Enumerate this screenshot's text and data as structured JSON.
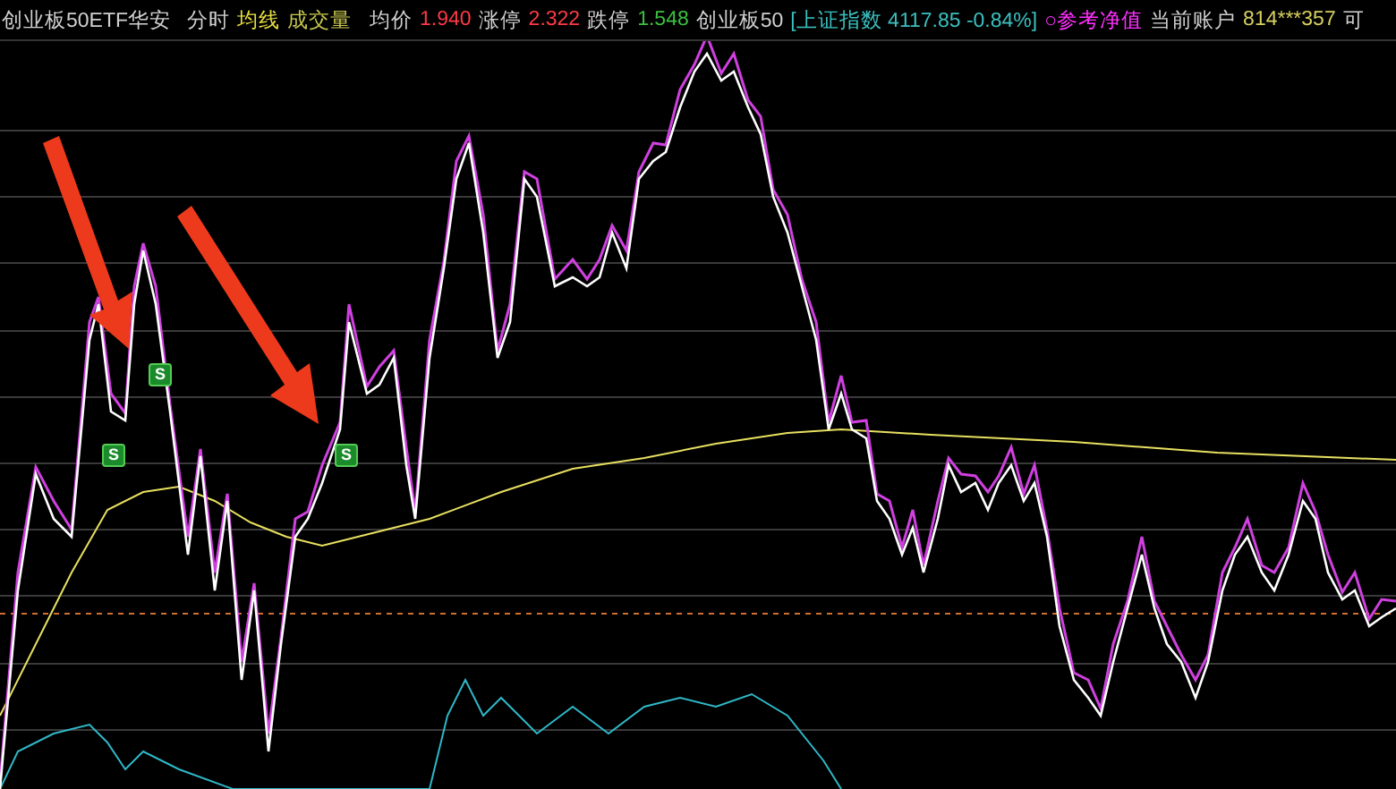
{
  "header": {
    "security": "创业板50ETF华安",
    "view": "分时",
    "indicators": [
      {
        "label": "均线",
        "color": "#e8e040"
      },
      {
        "label": "成交量",
        "color": "#c8c850"
      }
    ],
    "stats": [
      {
        "label": "均价",
        "value": "1.940",
        "kind": "up"
      },
      {
        "label": "涨停",
        "value": "2.322",
        "kind": "up"
      },
      {
        "label": "跌停",
        "value": "1.548",
        "kind": "down"
      }
    ],
    "index_name": "创业板50",
    "index_quote": "[上证指数 4117.85 -0.84%]",
    "reference": "○参考净值",
    "account_label": "当前账户",
    "account": "814***357",
    "cut_text": "可"
  },
  "chart": {
    "signals": [
      {
        "label": "S"
      },
      {
        "label": "S"
      },
      {
        "label": "S"
      }
    ]
  }
}
